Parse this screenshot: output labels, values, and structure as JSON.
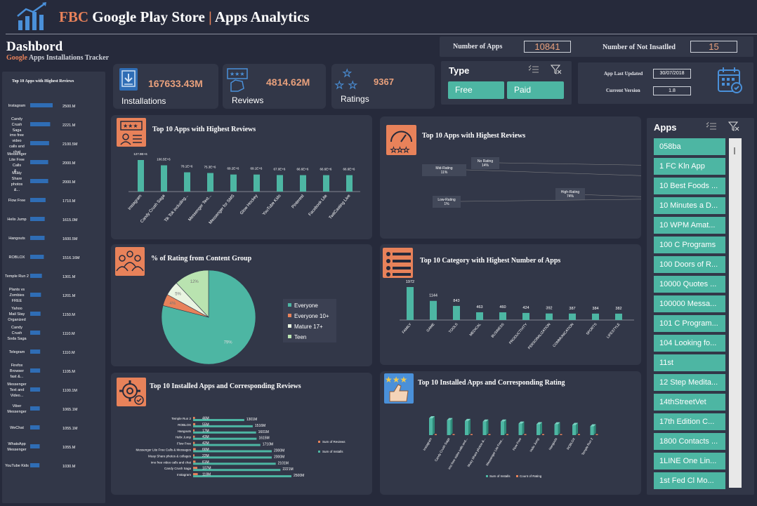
{
  "header": {
    "title_prefix": "FBC",
    "title_main": "Google Play Store",
    "title_sep": "|",
    "title_suffix": "Apps Analytics"
  },
  "dashboard": {
    "title": "Dashbord",
    "subtitle_accent": "Google",
    "subtitle_rest": "Apps Installations Tracker"
  },
  "kpis": {
    "installations_value": "167633.43M",
    "installations_label": "Installations",
    "reviews_value": "4814.62M",
    "reviews_label": "Reviews",
    "ratings_value": "9367",
    "ratings_label": "Ratings"
  },
  "counts": {
    "apps_label": "Number of Apps",
    "apps_value": "10841",
    "not_installed_label": "Number of Not Insatlled",
    "not_installed_value": "15"
  },
  "type_filter": {
    "label": "Type",
    "options": [
      "Free",
      "Paid"
    ]
  },
  "app_info": {
    "last_updated_label": "App Last Updated",
    "last_updated_value": "30/07/2018",
    "version_label": "Current Version",
    "version_value": "1.8"
  },
  "apps_slicer": {
    "label": "Apps",
    "items": [
      "058ba",
      "1 FC Kln App",
      "10 Best Foods ...",
      "10 Minutes a D...",
      "10 WPM Amat...",
      "100 C Programs",
      "100 Doors of R...",
      "10000 Quotes ...",
      "100000 Messa...",
      "101 C Program...",
      "104 Looking fo...",
      "11st",
      "12 Step Medita...",
      "14thStreetVet",
      "17th Edition C...",
      "1800 Contacts ...",
      "1LINE One Lin...",
      "1st Fed Cl Mo..."
    ]
  },
  "colors": {
    "teal": "#4db6a3",
    "orange": "#e8825a",
    "background": "#262a3b",
    "panel": "#323748"
  },
  "left_panel": {
    "title": "Top 10 Apps with Highest Reviews",
    "chart_data": {
      "type": "bar",
      "orientation": "horizontal",
      "categories": [
        "Instagram",
        "Candy Crush Saga",
        "imo free video calls and chat",
        "Messenger Lite Free Calls &...",
        "Muay Share photos &...",
        "Flow Free",
        "Helix Jump",
        "Hangouts",
        "ROBLOX",
        "Temple Run 2",
        "Plants vs Zombies FREE",
        "Yahoo Mail Stay Organized",
        "Candy Crush Soda Saga",
        "Telegram",
        "Firefox Browser fast &...",
        "Messenger Text and Video...",
        "Viber Messenger",
        "WeChat",
        "WhatsApp Messenger",
        "YouTube Kids"
      ],
      "values": [
        2500,
        2221,
        2100.5,
        2000,
        2000,
        1710,
        1615,
        1600.5,
        1516.16,
        1301,
        1201,
        1150,
        1110,
        1110,
        1105,
        1100.1,
        1065.1,
        1055.1,
        1055,
        1030
      ],
      "value_labels": [
        "2500.M",
        "2221.M",
        "2100.5M",
        "2000.M",
        "2000.M",
        "1710.M",
        "1615.0M",
        "1600.5M",
        "1516.16M",
        "1301.M",
        "1201.M",
        "1150.M",
        "1110.M",
        "1110.M",
        "1105.M",
        "1100.1M",
        "1065.1M",
        "1055.1M",
        "1055.M",
        "1030.M"
      ]
    }
  },
  "panel_reviews": {
    "title": "Top 10 Apps with Highest Reviews",
    "chart_data": {
      "type": "bar",
      "categories": [
        "Instagram",
        "Candy Crush Saga",
        "Tik Tok including...",
        "Messenger Text...",
        "Messenger for SMS",
        "Glow Hockey",
        "YouTube Kids",
        "Pinterest",
        "Facebook Lite",
        "TwitCasting Live"
      ],
      "values": [
        127.9,
        106.5,
        78.1,
        75.3,
        69.2,
        69.1,
        67.0,
        66.6,
        66.6,
        66.6
      ],
      "value_labels": [
        "127.9E+6",
        "106.5E+6",
        "78.1E+6",
        "75.3E+6",
        "69.2E+6",
        "69.1E+6",
        "67.0E+6",
        "66.6E+6",
        "66.6E+6",
        "66.6E+6"
      ]
    }
  },
  "panel_rating_donut": {
    "title": "Top 10 Apps with Highest Reviews",
    "chart_data": {
      "type": "pie",
      "categories": [
        "High-Rating",
        "Low-Rating",
        "Mid-Rating",
        "No Rating"
      ],
      "values": [
        74,
        1,
        11,
        14
      ],
      "labels": [
        "High-Rating\n74%",
        "Low-Rating\n1%",
        "Mid-Rating\n11%",
        "No Rating\n14%"
      ]
    }
  },
  "panel_content_group": {
    "title": "% of Rating from Content Group",
    "chart_data": {
      "type": "pie",
      "categories": [
        "Everyone",
        "Everyone 10+",
        "Mature 17+",
        "Teen"
      ],
      "values": [
        79,
        4,
        5,
        12
      ],
      "value_labels": [
        "79%",
        "4%",
        "5%",
        "12%"
      ],
      "legend": "right"
    }
  },
  "panel_category": {
    "title": "Top 10 Category with Highest Number of Apps",
    "chart_data": {
      "type": "bar",
      "categories": [
        "FAMILY",
        "GAME",
        "TOOLS",
        "MEDICAL",
        "BUSINESS",
        "PRODUCTIVITY",
        "PERSONALIZATION",
        "COMMUNICATION",
        "SPORTS",
        "LIFESTYLE"
      ],
      "values": [
        1972,
        1144,
        843,
        463,
        460,
        424,
        392,
        387,
        384,
        382
      ]
    }
  },
  "panel_installed_reviews": {
    "title": "Top 10 Installed Apps and Corresponding Reviews",
    "legend": [
      "Sum of Reviews",
      "Sum of Installs"
    ],
    "chart_data": {
      "type": "bar",
      "orientation": "horizontal",
      "categories": [
        "Temple Run 2",
        "ROBLOX",
        "Hangouts",
        "Helix Jump",
        "Flow Free",
        "Messenger Lite Free Calls & Messages",
        "Muay Share photos & collages",
        "imo free video calls and chat",
        "Candy Crush Saga",
        "Instagram"
      ],
      "series": [
        {
          "name": "Sum of Reviews",
          "values": [
            46,
            55,
            17,
            43,
            42,
            66,
            22,
            61,
            107,
            118
          ],
          "labels": [
            "46M",
            "55M",
            "17M",
            "43M",
            "42M",
            "66M",
            "22M",
            "61M",
            "107M",
            "118M"
          ]
        },
        {
          "name": "Sum of Installs",
          "values": [
            1301,
            1516,
            1601,
            1615,
            1710,
            2000,
            2000,
            2101,
            2221,
            2500
          ],
          "labels": [
            "1301M",
            "1516M",
            "1601M",
            "1615M",
            "1710M",
            "2000M",
            "2000M",
            "2101M",
            "2221M",
            "2500M"
          ]
        }
      ]
    }
  },
  "panel_installed_rating": {
    "title": "Top 10 Installed Apps and Corresponding Rating",
    "legend": [
      "Sum of Installs",
      "Count of Rating"
    ],
    "chart_data": {
      "type": "bar",
      "categories": [
        "Instagram",
        "Candy Crush Saga",
        "imo free video calls and...",
        "Muay Share photos &...",
        "Messenger Lite Free...",
        "Flow Free",
        "Helix Jump",
        "Hangouts",
        "ROBLOX",
        "Temple Run 2"
      ],
      "series": [
        {
          "name": "Sum of Installs",
          "values": [
            2500,
            2221,
            2101,
            2000,
            2000,
            1710,
            1615,
            1601,
            1516,
            1301
          ]
        },
        {
          "name": "Count of Rating",
          "values": [
            4.5,
            4.4,
            4.3,
            4.3,
            4.4,
            4.3,
            4.2,
            4.0,
            4.5,
            4.3
          ]
        }
      ]
    }
  }
}
